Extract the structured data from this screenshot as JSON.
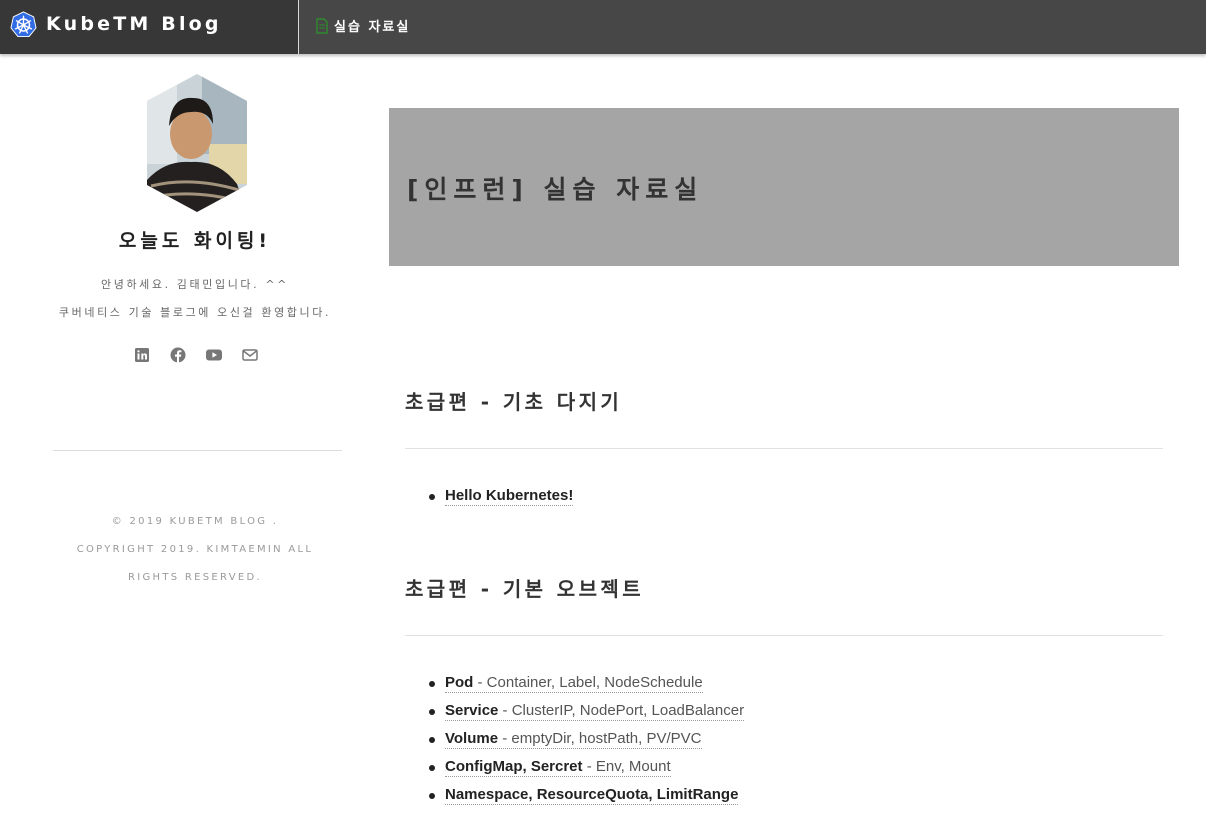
{
  "header": {
    "brand_title": "KubeTM Blog",
    "nav_label": "실습 자료실"
  },
  "sidebar": {
    "title": "오늘도 화이팅!",
    "intro_line1": "안녕하세요. 김태민입니다. ^^",
    "intro_line2": "쿠버네티스 기술 블로그에 오신걸 환영합니다.",
    "social_icons": [
      "linkedin-icon",
      "facebook-icon",
      "youtube-icon",
      "envelope-icon"
    ],
    "copyright_line1": "© 2019 KUBETM BLOG .",
    "copyright_line2": "COPYRIGHT 2019. KIMTAEMIN ALL",
    "copyright_line3": "RIGHTS RESERVED."
  },
  "hero": {
    "title": "[인프런] 실습 자료실"
  },
  "sections": [
    {
      "title": "초급편 - 기초 다지기",
      "items": [
        {
          "strong": "Hello Kubernetes!",
          "desc": ""
        }
      ]
    },
    {
      "title": "초급편 - 기본 오브젝트",
      "items": [
        {
          "strong": "Pod",
          "desc": " - Container, Label, NodeSchedule"
        },
        {
          "strong": "Service",
          "desc": " - ClusterIP, NodePort, LoadBalancer"
        },
        {
          "strong": "Volume",
          "desc": " - emptyDir, hostPath, PV/PVC"
        },
        {
          "strong": "ConfigMap, Sercret",
          "desc": " - Env, Mount"
        },
        {
          "strong": "Namespace, ResourceQuota, LimitRange",
          "desc": ""
        }
      ]
    }
  ],
  "colors": {
    "topbar": "#474747",
    "brand_bg": "#373737",
    "hero_bg": "#a5a5a5",
    "kubernetes_blue": "#326ce5",
    "nav_icon_green": "#2e8b2e"
  }
}
